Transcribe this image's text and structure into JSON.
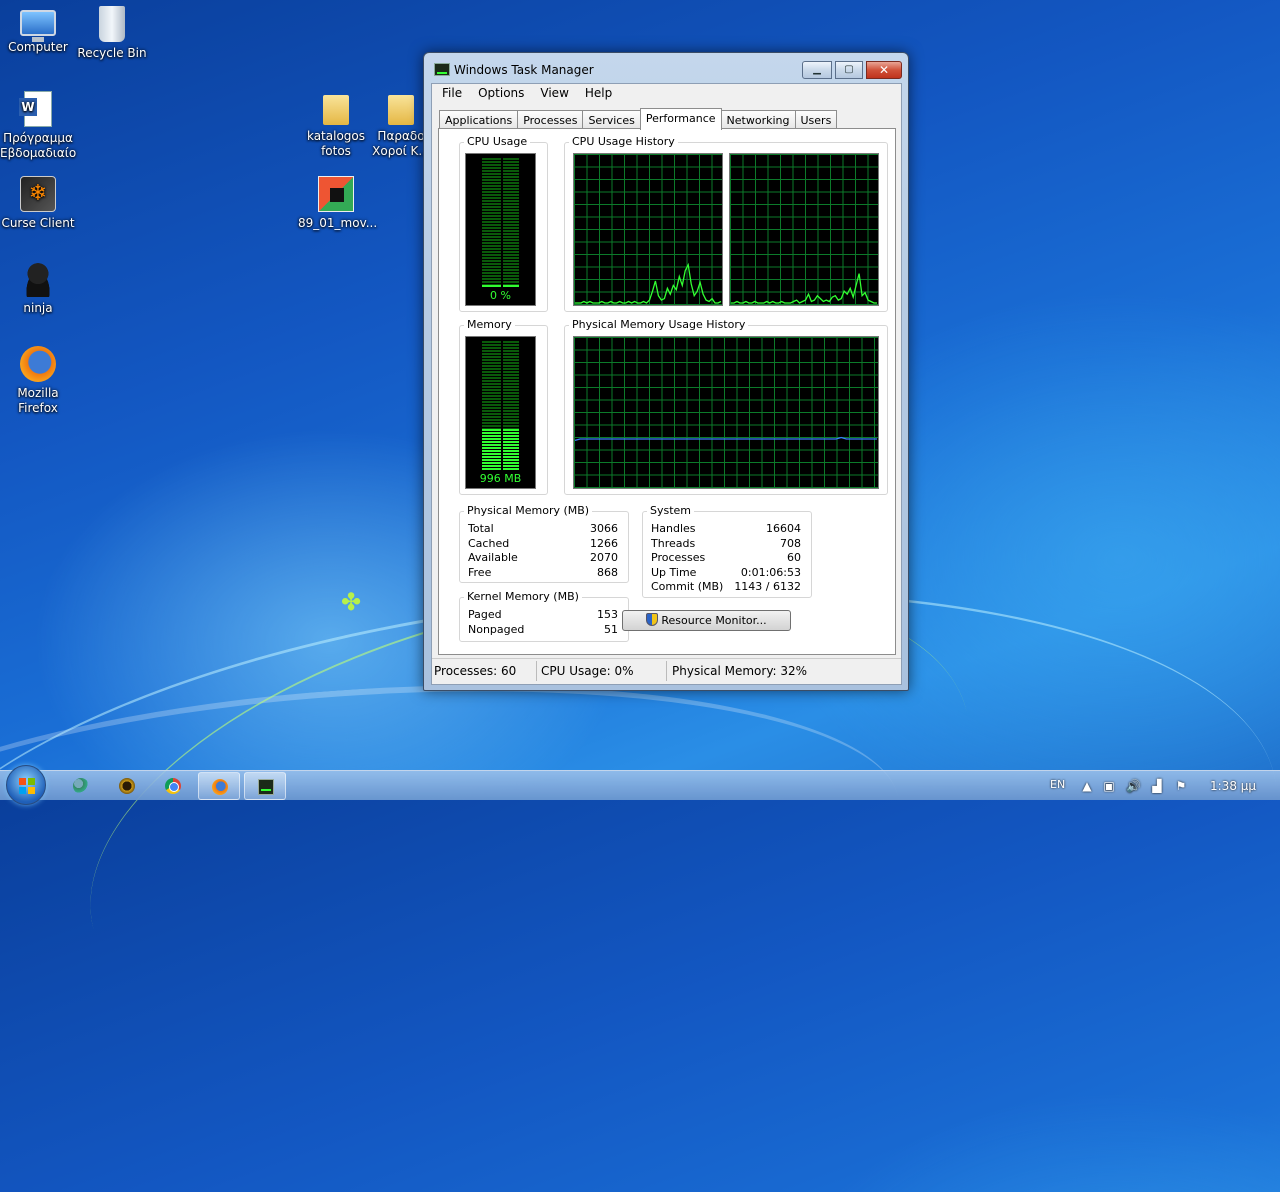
{
  "desktop": {
    "icons": [
      {
        "label": "Computer"
      },
      {
        "label": "Recycle Bin"
      },
      {
        "label": "Πρόγραμμα Εβδομαδιαίο"
      },
      {
        "label": "Curse Client"
      },
      {
        "label": "ninja"
      },
      {
        "label": "Mozilla Firefox"
      },
      {
        "label": "katalogos fotos"
      },
      {
        "label": "Παραδο Χοροί Κ..."
      },
      {
        "label": "89_01_mov..."
      }
    ]
  },
  "window": {
    "title": "Windows Task Manager",
    "caption_buttons": {
      "minimize": "▁",
      "maximize": "▢",
      "close": "✕"
    },
    "menu": [
      "File",
      "Options",
      "View",
      "Help"
    ],
    "tabs": [
      "Applications",
      "Processes",
      "Services",
      "Performance",
      "Networking",
      "Users"
    ],
    "active_tab": "Performance",
    "performance": {
      "cpu_usage": {
        "label": "CPU Usage",
        "value_text": "0 %",
        "level": 0.0
      },
      "cpu_history": {
        "label": "CPU Usage History",
        "core1": [
          0,
          0,
          0,
          1,
          0,
          1,
          0,
          0,
          0,
          1,
          0,
          0,
          1,
          0,
          0,
          1,
          0,
          0,
          1,
          0,
          1,
          0,
          0,
          1,
          0,
          2,
          8,
          15,
          5,
          2,
          3,
          10,
          6,
          12,
          9,
          18,
          12,
          22,
          26,
          13,
          5,
          8,
          14,
          6,
          2,
          1,
          3,
          0,
          0,
          1
        ],
        "core2": [
          0,
          0,
          1,
          0,
          0,
          1,
          0,
          0,
          1,
          0,
          0,
          0,
          1,
          0,
          1,
          0,
          0,
          1,
          0,
          0,
          0,
          1,
          2,
          0,
          1,
          2,
          6,
          1,
          2,
          5,
          3,
          1,
          2,
          1,
          4,
          5,
          2,
          3,
          8,
          6,
          10,
          4,
          12,
          20,
          5,
          7,
          2,
          1,
          0,
          0
        ]
      },
      "memory": {
        "label": "Memory",
        "value_text": "996 MB",
        "level": 0.32
      },
      "memory_history": {
        "label": "Physical Memory Usage History",
        "level": 0.32
      },
      "physical_memory": {
        "label": "Physical Memory (MB)",
        "rows": [
          {
            "k": "Total",
            "v": "3066"
          },
          {
            "k": "Cached",
            "v": "1266"
          },
          {
            "k": "Available",
            "v": "2070"
          },
          {
            "k": "Free",
            "v": "868"
          }
        ]
      },
      "kernel_memory": {
        "label": "Kernel Memory (MB)",
        "rows": [
          {
            "k": "Paged",
            "v": "153"
          },
          {
            "k": "Nonpaged",
            "v": "51"
          }
        ]
      },
      "system": {
        "label": "System",
        "rows": [
          {
            "k": "Handles",
            "v": "16604"
          },
          {
            "k": "Threads",
            "v": "708"
          },
          {
            "k": "Processes",
            "v": "60"
          },
          {
            "k": "Up Time",
            "v": "0:01:06:53"
          },
          {
            "k": "Commit (MB)",
            "v": "1143 / 6132"
          }
        ]
      },
      "resource_monitor_button": "Resource Monitor..."
    },
    "statusbar": {
      "processes": "Processes: 60",
      "cpu": "CPU Usage: 0%",
      "memory": "Physical Memory: 32%"
    }
  },
  "taskbar": {
    "apps": [
      "people-icon",
      "wow-icon",
      "chrome-icon",
      "firefox-icon",
      "task-manager-icon"
    ],
    "tray": {
      "language": "EN",
      "time": "1:38 μμ"
    }
  },
  "colors": {
    "graph_green": "#32ff32",
    "grid_green": "#0c7a2a",
    "memory_line": "#3a7cff"
  }
}
